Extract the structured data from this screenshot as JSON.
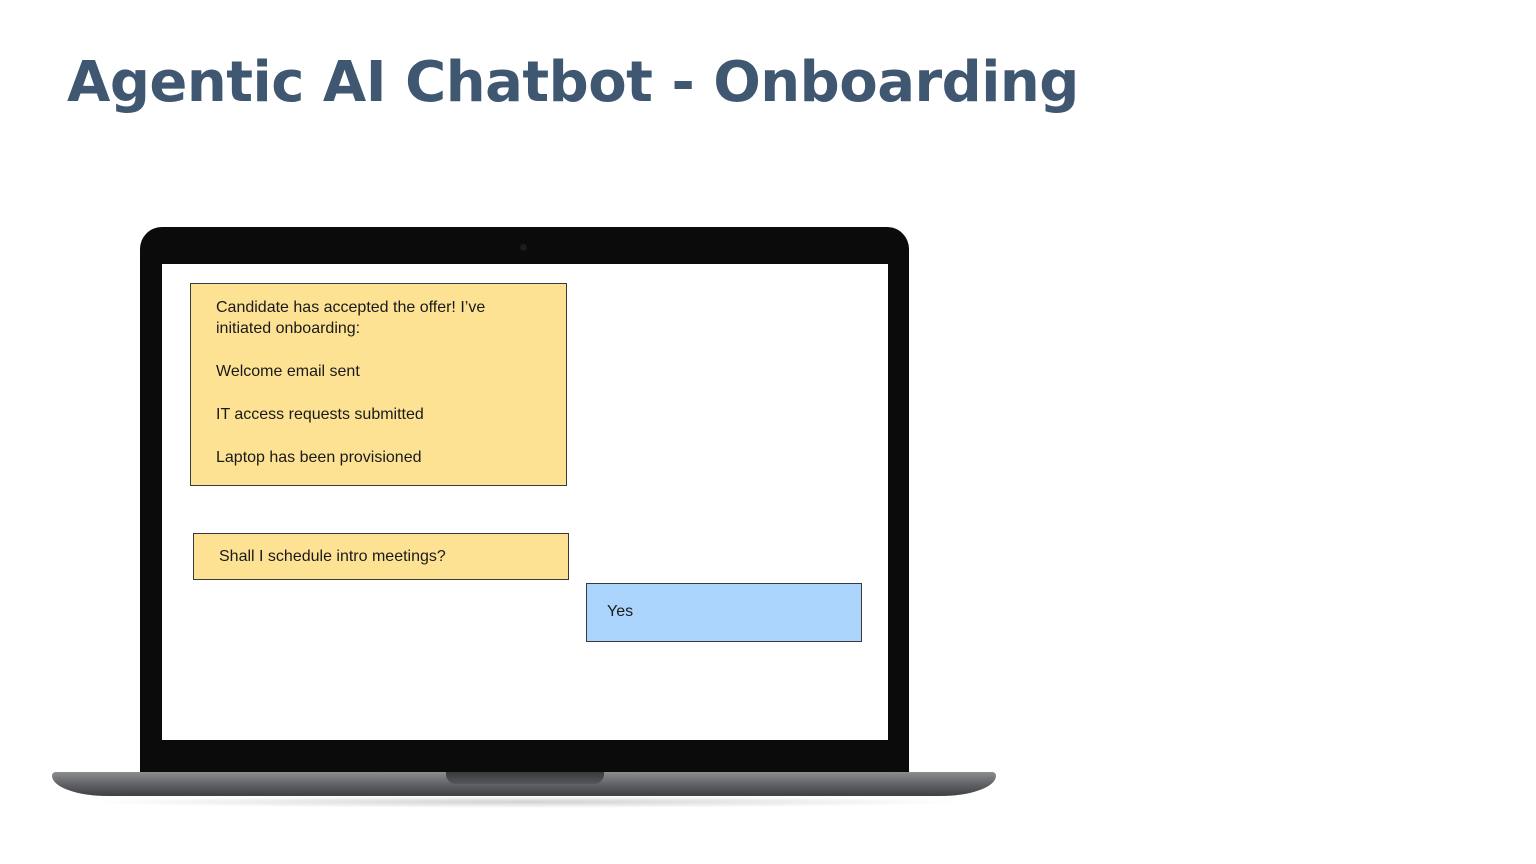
{
  "slide": {
    "title": "Agentic AI Chatbot - Onboarding"
  },
  "chat": {
    "messages": [
      {
        "sender": "bot",
        "intro": "Candidate has accepted the offer! I’ve initiated onboarding:",
        "items": [
          "Welcome email sent",
          "IT access requests submitted",
          "Laptop has been provisioned"
        ]
      },
      {
        "sender": "bot",
        "text": "Shall I schedule intro meetings?"
      },
      {
        "sender": "user",
        "text": "Yes"
      }
    ]
  },
  "colors": {
    "title": "#3f5770",
    "bot_bubble": "#fde293",
    "user_bubble": "#aad4fc",
    "laptop_bezel": "#0b0b0b",
    "laptop_base": "#5e5f63"
  }
}
